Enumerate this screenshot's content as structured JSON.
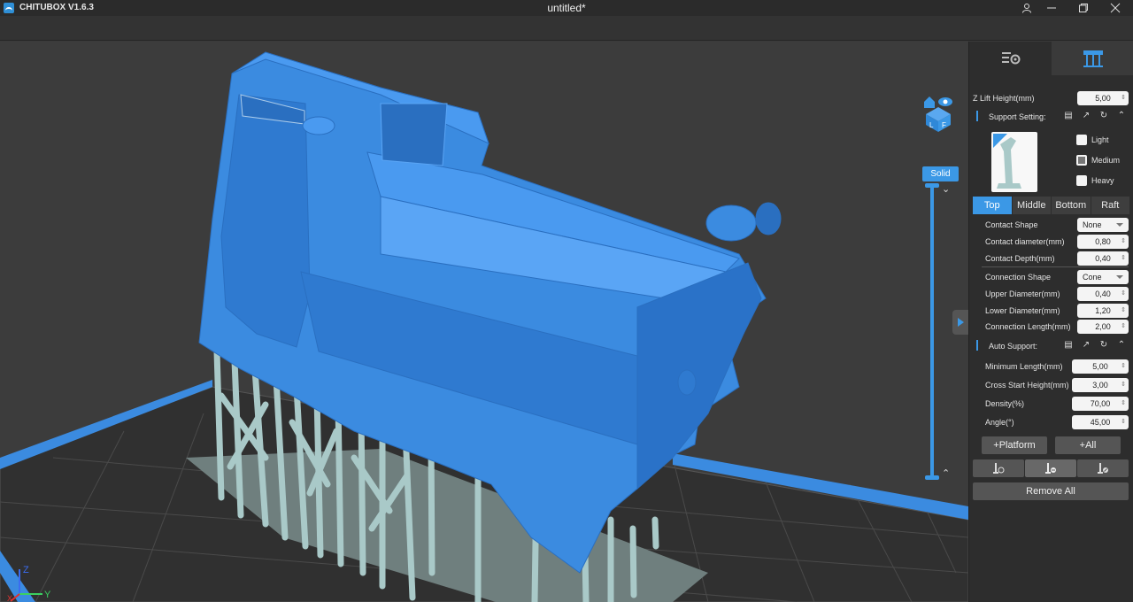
{
  "window": {
    "app_name": "CHITUBOX V1.6.3",
    "doc_title": "untitled*",
    "icons": [
      "user-icon",
      "minimize-icon",
      "maximize-icon",
      "close-icon"
    ]
  },
  "viewport": {
    "solid_label": "Solid",
    "axis": {
      "x": "X",
      "y": "Y",
      "z": "Z"
    },
    "model_color": "#3b8be0",
    "support_color": "#a9c9c8"
  },
  "panel": {
    "tabs": [
      "settings-tab",
      "support-tab"
    ],
    "z_lift": {
      "label": "Z Lift Height(mm)",
      "value": "5,00"
    },
    "support_setting": {
      "title": "Support Setting:",
      "presets": [
        {
          "label": "Light",
          "state": "unchecked"
        },
        {
          "label": "Medium",
          "state": "partial"
        },
        {
          "label": "Heavy",
          "state": "unchecked"
        }
      ],
      "subtabs": [
        "Top",
        "Middle",
        "Bottom",
        "Raft"
      ],
      "active_subtab": "Top",
      "fields": [
        {
          "label": "Contact Shape",
          "value": "None",
          "type": "dropdown"
        },
        {
          "label": "Contact diameter(mm)",
          "value": "0,80",
          "type": "spin"
        },
        {
          "label": "Contact Depth(mm)",
          "value": "0,40",
          "type": "spin"
        },
        {
          "label": "Connection Shape",
          "value": "Cone",
          "type": "dropdown"
        },
        {
          "label": "Upper Diameter(mm)",
          "value": "0,40",
          "type": "spin"
        },
        {
          "label": "Lower Diameter(mm)",
          "value": "1,20",
          "type": "spin"
        },
        {
          "label": "Connection Length(mm)",
          "value": "2,00",
          "type": "spin"
        }
      ]
    },
    "auto_support": {
      "title": "Auto Support:",
      "fields": [
        {
          "label": "Minimum Length(mm)",
          "value": "5,00"
        },
        {
          "label": "Cross Start Height(mm)",
          "value": "3,00"
        },
        {
          "label": "Density(%)",
          "value": "70,00"
        },
        {
          "label": "Angle(°)",
          "value": "45,00"
        }
      ]
    },
    "platform_label": "+Platform",
    "all_label": "+All",
    "remove_all_label": "Remove All"
  }
}
